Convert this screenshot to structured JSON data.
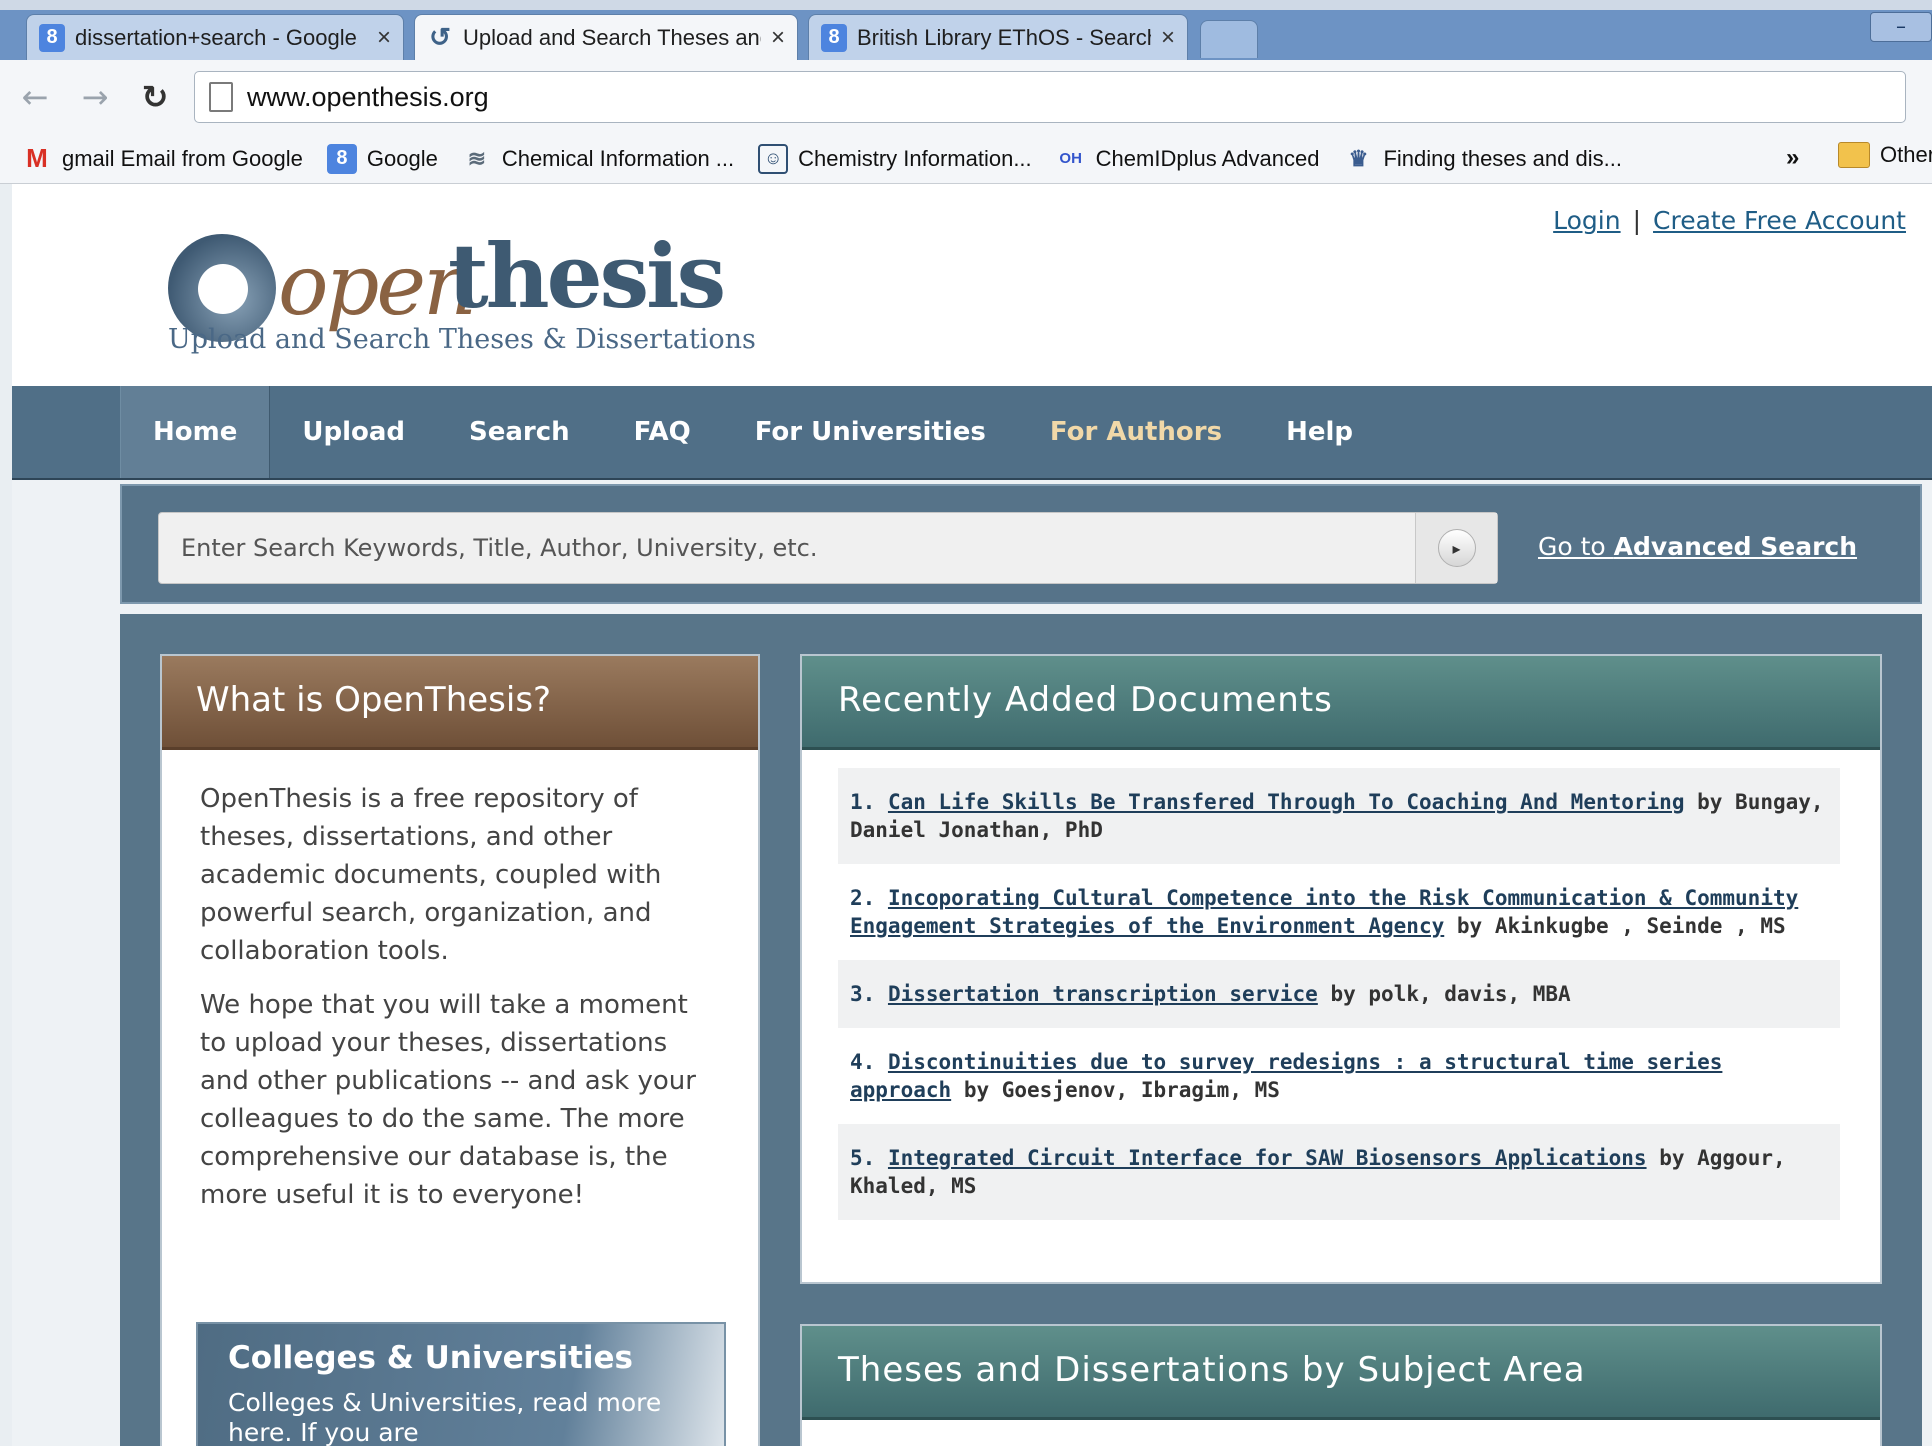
{
  "browser": {
    "tabs": [
      {
        "title": "dissertation+search - Google",
        "icon": "google-icon"
      },
      {
        "title": "Upload and Search Theses and",
        "icon": "openthesis-icon",
        "active": true
      },
      {
        "title": "British Library EThOS - Search",
        "icon": "google-icon"
      }
    ],
    "url": "www.openthesis.org",
    "bookmarks": [
      {
        "label": "gmail Email from Google",
        "icon": "gmail-icon"
      },
      {
        "label": "Google",
        "icon": "google-icon"
      },
      {
        "label": "Chemical Information ...",
        "icon": "cas-icon"
      },
      {
        "label": "Chemistry Information...",
        "icon": "chem-icon"
      },
      {
        "label": "ChemIDplus Advanced",
        "icon": "oh-icon"
      },
      {
        "label": "Finding theses and dis...",
        "icon": "shield-icon"
      }
    ],
    "more": "»",
    "other_bookmarks": "Other"
  },
  "header": {
    "logo_open": "open",
    "logo_thesis": "thesis",
    "tagline": "Upload and Search Theses & Dissertations",
    "login": "Login",
    "separator": "|",
    "create_account": "Create Free Account"
  },
  "nav": [
    "Home",
    "Upload",
    "Search",
    "FAQ",
    "For Universities",
    "For Authors",
    "Help"
  ],
  "search": {
    "placeholder": "Enter Search Keywords, Title, Author, University, etc.",
    "adv_prefix": "Go to ",
    "adv_bold": "Advanced Search"
  },
  "what": {
    "title": "What is OpenThesis?",
    "p1": "OpenThesis is a free repository of theses, dissertations, and other academic documents, coupled with powerful search, organization, and collaboration tools.",
    "p2": "We hope that you will take a moment to upload your theses, dissertations and other publications -- and ask your colleagues to do the same. The more comprehensive our database is, the more useful it is to everyone!"
  },
  "colleges": {
    "title": "Colleges & Universities",
    "body": "Colleges & Universities, read more here. If you are"
  },
  "recent": {
    "title": "Recently Added Documents",
    "items": [
      {
        "num": "1.",
        "title": "Can Life Skills Be Transfered Through To Coaching And Mentoring",
        "by": "by Bungay, Daniel Jonathan, PhD"
      },
      {
        "num": "2.",
        "title": "Incoporating Cultural Competence into the Risk Communication & Community Engagement Strategies of the Environment Agency",
        "by": "by Akinkugbe , Seinde , MS"
      },
      {
        "num": "3.",
        "title": "Dissertation transcription service",
        "by": "by polk, davis, MBA"
      },
      {
        "num": "4.",
        "title": "Discontinuities due to survey redesigns : a structural time series approach",
        "by": "by Goesjenov, Ibragim, MS"
      },
      {
        "num": "5.",
        "title": "Integrated Circuit Interface for SAW Biosensors Applications",
        "by": "by Aggour, Khaled, MS"
      }
    ]
  },
  "subjects": {
    "title": "Theses and Dissertations by Subject Area"
  }
}
